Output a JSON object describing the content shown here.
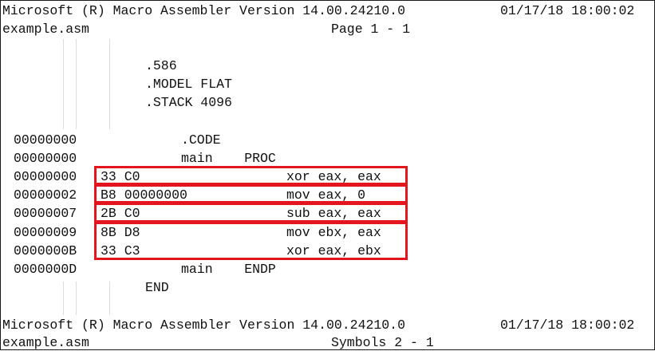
{
  "header_top": {
    "banner": "Microsoft (R) Macro Assembler Version 14.00.24210.0",
    "datetime": "01/17/18 18:00:02",
    "filename": "example.asm",
    "page": "Page 1 - 1"
  },
  "directives": [
    ".586",
    ".MODEL FLAT",
    ".STACK 4096"
  ],
  "listing": [
    {
      "addr": "00000000",
      "code": "",
      "text": ".CODE"
    },
    {
      "addr": "00000000",
      "code": "",
      "text": "main    PROC"
    },
    {
      "addr": "00000000",
      "code": "33 C0",
      "text": "xor eax, eax"
    },
    {
      "addr": "00000002",
      "code": "B8 00000000",
      "text": "mov eax, 0"
    },
    {
      "addr": "00000007",
      "code": "2B C0",
      "text": "sub eax, eax"
    },
    {
      "addr": "00000009",
      "code": "8B D8",
      "text": "mov ebx, eax"
    },
    {
      "addr": "0000000B",
      "code": "33 C3",
      "text": "xor eax, ebx"
    },
    {
      "addr": "0000000D",
      "code": "",
      "text": "main    ENDP"
    }
  ],
  "end_directive": "END",
  "footer": {
    "banner": "Microsoft (R) Macro Assembler Version 14.00.24210.0",
    "datetime": "01/17/18 18:00:02",
    "filename": "example.asm",
    "page": "Symbols 2 - 1"
  },
  "highlight_color": "#e3151f"
}
